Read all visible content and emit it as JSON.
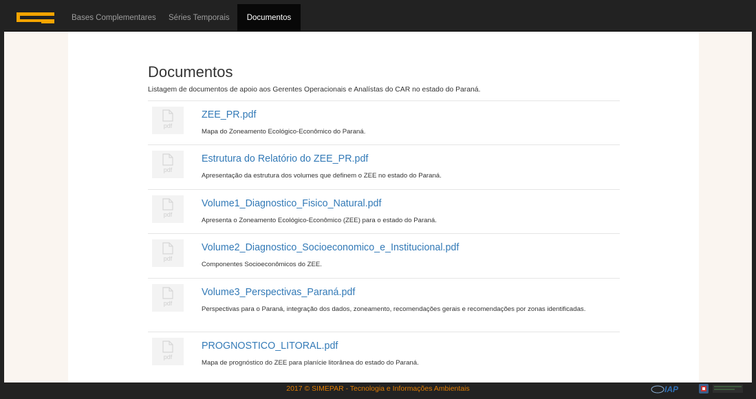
{
  "nav": {
    "items": [
      {
        "label": "Bases Complementares",
        "active": false
      },
      {
        "label": "Séries Temporais",
        "active": false
      },
      {
        "label": "Documentos",
        "active": true
      }
    ]
  },
  "page": {
    "title": "Documentos",
    "description": "Listagem de documentos de apoio aos Gerentes Operacionais e Analístas do CAR no estado do Paraná."
  },
  "documents": [
    {
      "name": "ZEE_PR.pdf",
      "icon_label": "pdf",
      "description": "Mapa do Zoneamento Ecológico-Econômico do Paraná."
    },
    {
      "name": "Estrutura do Relatório do ZEE_PR.pdf",
      "icon_label": "pdf",
      "description": "Apresentação da estrutura dos volumes que definem o ZEE no estado do Paraná."
    },
    {
      "name": "Volume1_Diagnostico_Fisico_Natural.pdf",
      "icon_label": "pdf",
      "description": "Apresenta o Zoneamento Ecológico-Econômico (ZEE) para o estado do Paraná."
    },
    {
      "name": "Volume2_Diagnostico_Socioeconomico_e_Institucional.pdf",
      "icon_label": "pdf",
      "description": "Componentes Socioeconômicos do ZEE."
    },
    {
      "name": "Volume3_Perspectivas_Paraná.pdf",
      "icon_label": "pdf",
      "description": "Perspectivas para o Paraná, integração dos dados, zoneamento, recomendações gerais e recomendações por zonas identificadas."
    },
    {
      "name": "PROGNOSTICO_LITORAL.pdf",
      "icon_label": "pdf",
      "description": "Mapa de prognóstico do ZEE para planície litorânea do estado do Paraná."
    }
  ],
  "footer": {
    "text": "2017 © SIMEPAR - Tecnologia e Informações Ambientais",
    "logo_iap": "IAP"
  },
  "colors": {
    "navbar": "#222222",
    "link": "#337ab7",
    "footer_text": "#e07b00",
    "logo": "#f5a400"
  }
}
